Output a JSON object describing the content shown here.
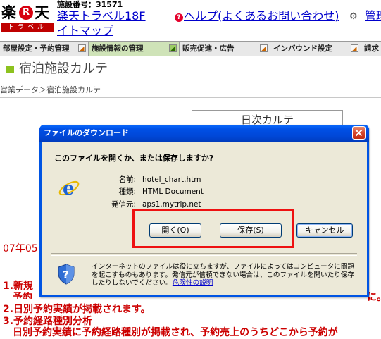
{
  "header": {
    "logo": {
      "raku": "楽",
      "r_mark": "R",
      "ten": "天",
      "travel": "トラベル"
    },
    "facility_number": "施設番号：31571",
    "site_title": "楽天トラベル18F",
    "sitemap_link": "イトマップ",
    "help_link": "ヘルプ(よくあるお問い合わせ)",
    "admin_link": "管理"
  },
  "nav": {
    "tabs": [
      {
        "label": "部屋設定・予約管理",
        "active": false
      },
      {
        "label": "施設情報の管理",
        "active": true
      },
      {
        "label": "販売促進・広告",
        "active": false
      },
      {
        "label": "インバウンド設定",
        "active": false
      },
      {
        "label": "請求",
        "active": false
      }
    ]
  },
  "page": {
    "heading": "宿泊施設カルテ",
    "breadcrumb": "営業データ＞宿泊施設カルテ",
    "daily_karte_button": "日次カルテ"
  },
  "background_text": {
    "year_fragment": "07年05",
    "item1": "1.新規",
    "item1_cont": "予約",
    "item1_right_fragment": "に。",
    "item2": "2.日別予約実績が掲載されます。",
    "item3": "3.予約経路種別分析",
    "item3_sub": "日別予約実績に予約経路種別が掲載され、予約売上のうちどこから予約が"
  },
  "dialog": {
    "title": "ファイルのダウンロード",
    "question": "このファイルを開くか、または保存しますか?",
    "file_info": {
      "name_label": "名前:",
      "name_value": "hotel_chart.htm",
      "type_label": "種類:",
      "type_value": "HTML Document",
      "from_label": "発信元:",
      "from_value": "aps1.mytrip.net"
    },
    "buttons": {
      "open": "開く(O)",
      "save": "保存(S)",
      "cancel": "キャンセル"
    },
    "warning": {
      "text": "インターネットのファイルは役に立ちますが、ファイルによってはコンピュータに問題を起こすものもあります。発信元が信頼できない場合は、このファイルを開いたり保存したりしないでください。",
      "link": "危険性の説明"
    },
    "colors": {
      "titlebar": "#0046d5",
      "highlight": "#ee1111",
      "body": "#ece9d8"
    }
  }
}
